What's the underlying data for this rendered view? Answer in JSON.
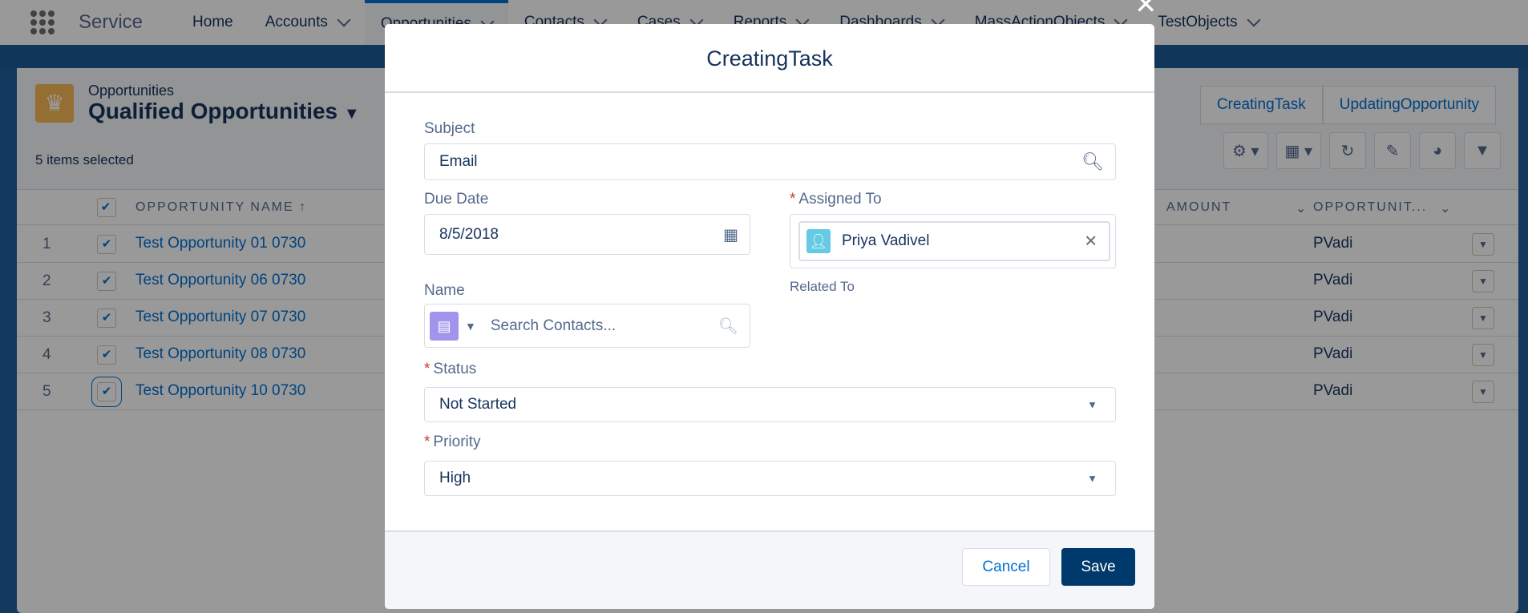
{
  "nav": {
    "app_name": "Service",
    "items": [
      {
        "label": "Home",
        "chevron": false
      },
      {
        "label": "Accounts",
        "chevron": true
      },
      {
        "label": "Opportunities",
        "chevron": true,
        "active": true
      },
      {
        "label": "Contacts",
        "chevron": true
      },
      {
        "label": "Cases",
        "chevron": true
      },
      {
        "label": "Reports",
        "chevron": true
      },
      {
        "label": "Dashboards",
        "chevron": true
      },
      {
        "label": "MassActionObjects",
        "chevron": true
      },
      {
        "label": "TestObjects",
        "chevron": true
      }
    ]
  },
  "list": {
    "object_label": "Opportunities",
    "list_name": "Qualified Opportunities",
    "selected_text": "5 items selected",
    "action_buttons": [
      "CreatingTask",
      "UpdatingOpportunity"
    ],
    "columns": {
      "name": "OPPORTUNITY NAME",
      "amount": "AMOUNT",
      "owner": "OPPORTUNIT..."
    },
    "rows": [
      {
        "num": "1",
        "name": "Test Opportunity 01 0730",
        "owner": "PVadi",
        "checked": true
      },
      {
        "num": "2",
        "name": "Test Opportunity 06 0730",
        "owner": "PVadi",
        "checked": true
      },
      {
        "num": "3",
        "name": "Test Opportunity 07 0730",
        "owner": "PVadi",
        "checked": true
      },
      {
        "num": "4",
        "name": "Test Opportunity 08 0730",
        "owner": "PVadi",
        "checked": true
      },
      {
        "num": "5",
        "name": "Test Opportunity 10 0730",
        "owner": "PVadi",
        "checked": true
      }
    ]
  },
  "modal": {
    "title": "CreatingTask",
    "subject": {
      "label": "Subject",
      "value": "Email"
    },
    "due_date": {
      "label": "Due Date",
      "value": "8/5/2018"
    },
    "assigned_to": {
      "label": "Assigned To",
      "value": "Priya Vadivel",
      "required": true
    },
    "related_to": {
      "label": "Related To"
    },
    "name": {
      "label": "Name",
      "placeholder": "Search Contacts..."
    },
    "status": {
      "label": "Status",
      "value": "Not Started",
      "required": true
    },
    "priority": {
      "label": "Priority",
      "value": "High",
      "required": true
    },
    "cancel": "Cancel",
    "save": "Save"
  },
  "colors": {
    "brand": "#0070d2",
    "save_button": "#00396b",
    "required": "#c23934"
  }
}
